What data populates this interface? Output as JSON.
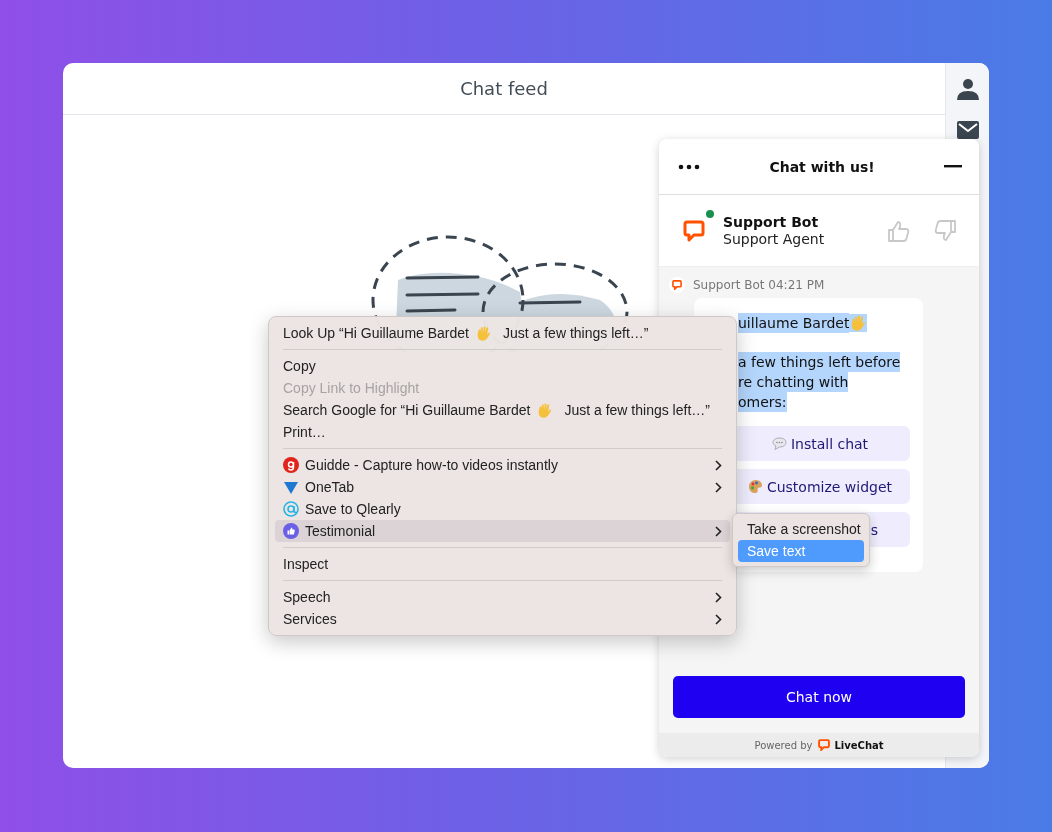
{
  "feed": {
    "title": "Chat feed"
  },
  "widget": {
    "title": "Chat with us!",
    "agent": {
      "name": "Support Bot",
      "role": "Support Agent",
      "online": true
    },
    "message": {
      "meta": "Support Bot 04:21 PM",
      "paragraphs": [
        [
          {
            "text": "uillaume Bardet",
            "wave": true
          }
        ],
        [
          {
            "text": "a few things left before",
            "wave": false
          },
          {
            "text": "re chatting with",
            "wave": false
          },
          {
            "text": "omers:",
            "wave": false
          }
        ]
      ],
      "actions": [
        {
          "label": "Install chat",
          "kind": "chat"
        },
        {
          "label": "Customize widget",
          "kind": "palette"
        },
        {
          "label": "s",
          "kind": "hidden"
        }
      ]
    },
    "button": "Chat now",
    "footer": {
      "prefix": "Powered by",
      "brand": "LiveChat"
    }
  },
  "context_menu": {
    "items": [
      {
        "kind": "item",
        "label": "Look Up “Hi Guillaume Bardet",
        "label_end": "Just a few things left…”",
        "disabled": false,
        "selected": false,
        "submenu": false
      },
      {
        "kind": "separator"
      },
      {
        "kind": "item",
        "label": "Copy",
        "disabled": false,
        "selected": false,
        "submenu": false
      },
      {
        "kind": "item",
        "label": "Copy Link to Highlight",
        "disabled": true,
        "selected": false,
        "submenu": false
      },
      {
        "kind": "item",
        "label": "Search Google for “Hi Guillaume Bardet",
        "label_end": "Just a few things left…”",
        "disabled": false,
        "selected": false,
        "submenu": false
      },
      {
        "kind": "item",
        "label": "Print…",
        "disabled": false,
        "selected": false,
        "submenu": false
      },
      {
        "kind": "separator"
      },
      {
        "kind": "extension",
        "label": "Guidde - Capture how-to videos instantly",
        "color": "#e0241b",
        "disabled": false,
        "selected": false,
        "submenu": true
      },
      {
        "kind": "extension",
        "label": "OneTab",
        "color": "#1f78d1",
        "disabled": false,
        "selected": false,
        "submenu": true
      },
      {
        "kind": "extension",
        "label": "Save to Qlearly",
        "color": "#27b4e6",
        "disabled": false,
        "selected": false,
        "submenu": false
      },
      {
        "kind": "extension",
        "label": "Testimonial",
        "color": "#6b5fe6",
        "disabled": false,
        "selected": true,
        "submenu": true
      },
      {
        "kind": "separator"
      },
      {
        "kind": "item",
        "label": "Inspect",
        "disabled": false,
        "selected": false,
        "submenu": false
      },
      {
        "kind": "separator"
      },
      {
        "kind": "item",
        "label": "Speech",
        "disabled": false,
        "selected": false,
        "submenu": true
      },
      {
        "kind": "item",
        "label": "Services",
        "disabled": false,
        "selected": false,
        "submenu": true
      }
    ]
  },
  "submenu": {
    "items": [
      {
        "label": "Take a screenshot",
        "selected": false
      },
      {
        "label": "Save text",
        "selected": true
      }
    ]
  }
}
